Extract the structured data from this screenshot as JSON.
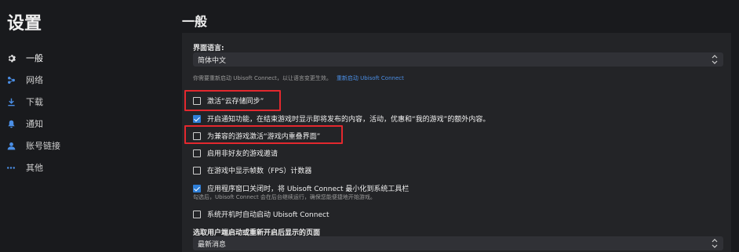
{
  "app_title": "设置",
  "nav": [
    {
      "label": "一般",
      "icon": "gear-icon",
      "active": true
    },
    {
      "label": "网络",
      "icon": "network-icon",
      "active": false
    },
    {
      "label": "下载",
      "icon": "download-icon",
      "active": false
    },
    {
      "label": "通知",
      "icon": "bell-icon",
      "active": false
    },
    {
      "label": "账号链接",
      "icon": "user-icon",
      "active": false
    },
    {
      "label": "其他",
      "icon": "more-icon",
      "active": false
    }
  ],
  "section_title": "一般",
  "language": {
    "label": "界面语言:",
    "value": "简体中文",
    "help_text": "你需要重新启动 Ubisoft Connect，以让语言变更生效。",
    "restart_link": "重新启动 Ubisoft Connect"
  },
  "options": [
    {
      "label": "激活“云存储同步”",
      "checked": false
    },
    {
      "label": "开启通知功能，在结束游戏时显示即将发布的内容，活动，优惠和“我的游戏”的额外内容。",
      "checked": true
    },
    {
      "label": "为兼容的游戏激活“游戏内重叠界面”",
      "checked": false
    },
    {
      "label": "启用非好友的游戏邀请",
      "checked": false
    },
    {
      "label": "在游戏中显示帧数（FPS）计数器",
      "checked": false
    },
    {
      "label": "应用程序窗口关闭时，将 Ubisoft Connect 最小化到系统工具栏",
      "checked": true
    },
    {
      "label": "系统开机时自动启动 Ubisoft Connect",
      "checked": false
    }
  ],
  "minimize_note": "勾选后，Ubisoft Connect 会在后台继续运行，确保您能便捷地开始游戏。",
  "startup_page": {
    "label": "选取用户端启动或重新开启后显示的页面",
    "value": "最新消息"
  },
  "colors": {
    "accent": "#2f7fd8",
    "link": "#4b8fe6",
    "highlight": "#e3282e",
    "background": "#191a1d",
    "panel": "#232427"
  }
}
